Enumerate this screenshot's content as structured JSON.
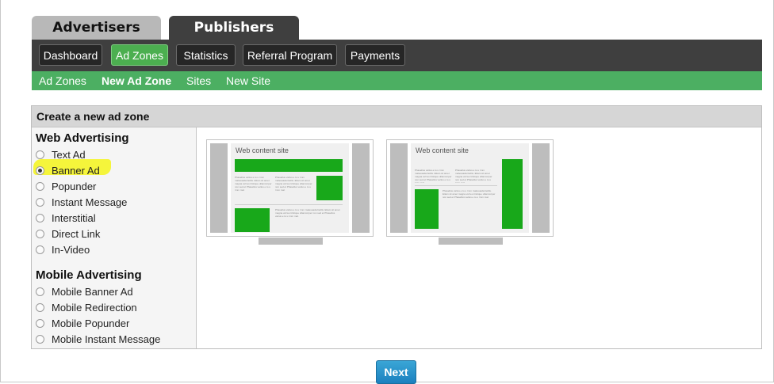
{
  "top_tabs": {
    "advertisers": "Advertisers",
    "publishers": "Publishers"
  },
  "nav": [
    "Dashboard",
    "Ad Zones",
    "Statistics",
    "Referral Program",
    "Payments"
  ],
  "subnav": [
    "Ad Zones",
    "New Ad Zone",
    "Sites",
    "New Site"
  ],
  "panel": {
    "title": "Create a new ad zone",
    "web_title": "Web Advertising",
    "web_options": [
      "Text Ad",
      "Banner Ad",
      "Popunder",
      "Instant Message",
      "Interstitial",
      "Direct Link",
      "In-Video"
    ],
    "mobile_title": "Mobile Advertising",
    "mobile_options": [
      "Mobile Banner Ad",
      "Mobile Redirection",
      "Mobile Popunder",
      "Mobile Instant Message"
    ],
    "selected": "Banner Ad"
  },
  "previews": [
    {
      "site_title": "Web content site"
    },
    {
      "site_title": "Web content site"
    }
  ],
  "filler_text": "Phasellus varius e to u rmm malesuada facilis. Etiam sit amet magna vel leo tristique ullamcorper non sed et Phasellus varius e to u rmm mal.",
  "next_label": "Next",
  "colors": {
    "nav_dark": "#3f3f3f",
    "accent_green": "#4caf50",
    "ad_green": "#18a81a",
    "next_blue": "#1b80bf"
  }
}
